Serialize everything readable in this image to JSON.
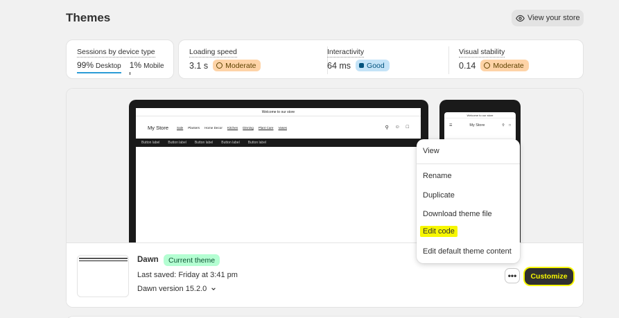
{
  "page": {
    "title": "Themes",
    "view_store_label": "View your store"
  },
  "sessions": {
    "label": "Sessions by device type",
    "desktop_pct": "99%",
    "desktop_label": "Desktop",
    "mobile_pct": "1%",
    "mobile_label": "Mobile"
  },
  "metrics": [
    {
      "label": "Loading speed",
      "value": "3.1 s",
      "badge": "Moderate"
    },
    {
      "label": "Interactivity",
      "value": "64 ms",
      "badge": "Good"
    },
    {
      "label": "Visual stability",
      "value": "0.14",
      "badge": "Moderate"
    }
  ],
  "preview": {
    "announcement": "Welcome to our store",
    "logo": "My Store",
    "nav": [
      "Sale",
      "Planters",
      "Home Decor",
      "Kitchen",
      "Dinning",
      "Plant Care",
      "Vases"
    ],
    "buttons": [
      "Button label",
      "Button label",
      "Button label",
      "Button label",
      "Button label"
    ],
    "phone_announcement": "Welcome to our store",
    "phone_logo": "My Store"
  },
  "theme": {
    "name": "Dawn",
    "badge": "Current theme",
    "last_saved": "Last saved: Friday at 3:41 pm",
    "version": "Dawn version 15.2.0",
    "more_label": "•••",
    "customize_label": "Customize"
  },
  "menu": {
    "items": [
      "View",
      "Rename",
      "Duplicate",
      "Download theme file",
      "Edit code",
      "Edit default theme content"
    ]
  },
  "colors": {
    "highlight": "#f7f700",
    "primary_button": "#303030",
    "moderate": "#fed3a7",
    "good": "#c4e3f7",
    "current": "#b4fed2"
  }
}
